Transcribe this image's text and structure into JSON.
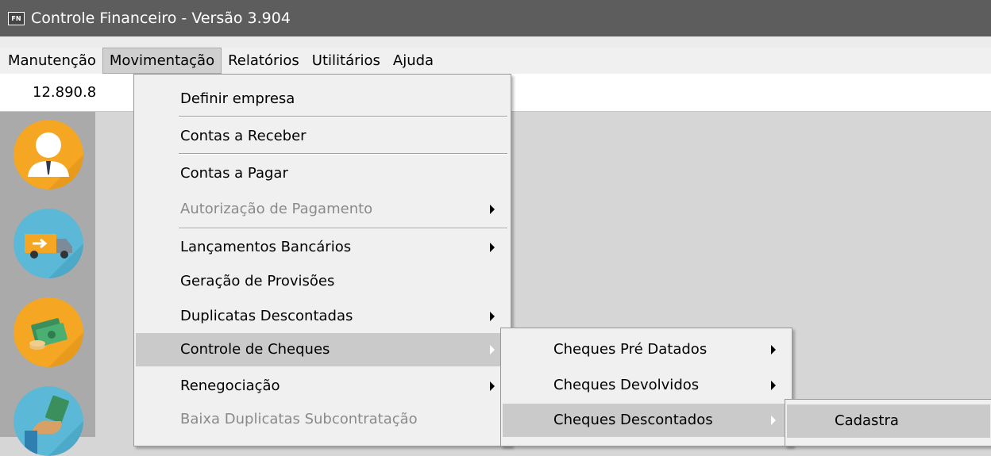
{
  "window": {
    "icon_label": "FN",
    "title": "Controle Financeiro - Versão 3.904"
  },
  "menubar": {
    "items": [
      "Manutenção",
      "Movimentação",
      "Relatórios",
      "Utilitários",
      "Ajuda"
    ]
  },
  "valuebar": {
    "value": "12.890.8"
  },
  "sidebar": {
    "icons": [
      "user-icon",
      "delivery-truck-icon",
      "money-icon",
      "payment-hand-icon"
    ],
    "colors": {
      "user": "#f5a623",
      "truck": "#5bb8d6",
      "money": "#f5a623",
      "hand": "#5bb8d6"
    }
  },
  "movimentacao_menu": {
    "items": [
      {
        "label": "Definir empresa"
      },
      {
        "label": "Contas a Receber"
      },
      {
        "label": "Contas a Pagar"
      },
      {
        "label": "Autorização de Pagamento"
      },
      {
        "label": "Lançamentos Bancários"
      },
      {
        "label": "Geração de Provisões"
      },
      {
        "label": "Duplicatas Descontadas"
      },
      {
        "label": "Controle de Cheques"
      },
      {
        "label": "Renegociação"
      },
      {
        "label": "Baixa Duplicatas Subcontratação"
      }
    ]
  },
  "cheques_menu": {
    "items": [
      {
        "label": "Cheques Pré Datados"
      },
      {
        "label": "Cheques Devolvidos"
      },
      {
        "label": "Cheques Descontados"
      }
    ]
  },
  "descontados_menu": {
    "items": [
      {
        "label": "Cadastra"
      }
    ]
  }
}
